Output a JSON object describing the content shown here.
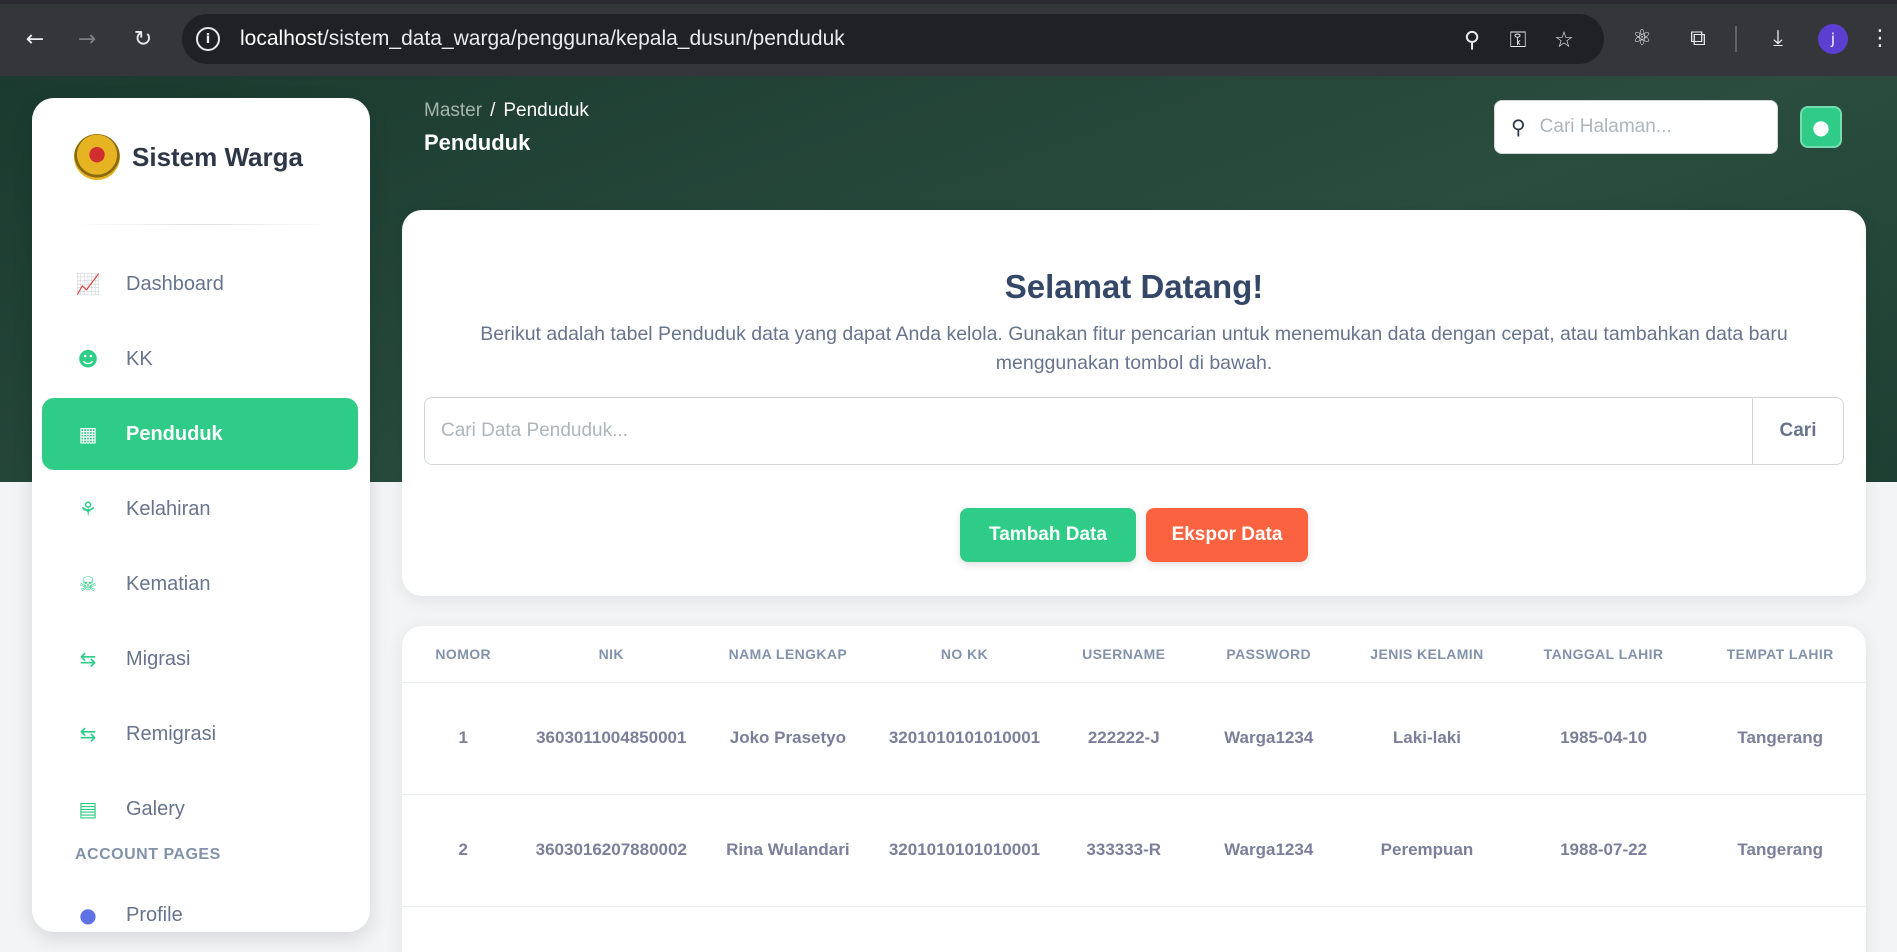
{
  "browser": {
    "url_host": "localhost",
    "url_path": "/sistem_data_warga/pengguna/kepala_dusun/penduduk",
    "profile_initial": "j"
  },
  "sidebar": {
    "brand": "Sistem Warga",
    "items": [
      {
        "label": "Dashboard",
        "icon": "chart-icon"
      },
      {
        "label": "KK",
        "icon": "users-icon"
      },
      {
        "label": "Penduduk",
        "icon": "id-card-icon",
        "active": true
      },
      {
        "label": "Kelahiran",
        "icon": "baby-icon"
      },
      {
        "label": "Kematian",
        "icon": "skull-icon"
      },
      {
        "label": "Migrasi",
        "icon": "exchange-icon"
      },
      {
        "label": "Remigrasi",
        "icon": "exchange-icon"
      },
      {
        "label": "Galery",
        "icon": "images-icon"
      }
    ],
    "section_label": "ACCOUNT PAGES",
    "account_items": [
      {
        "label": "Profile",
        "icon": "user-icon"
      }
    ]
  },
  "header": {
    "breadcrumb_root": "Master",
    "breadcrumb_sep": "/",
    "breadcrumb_current": "Penduduk",
    "title": "Penduduk",
    "search_placeholder": "Cari Halaman..."
  },
  "welcome": {
    "title": "Selamat Datang!",
    "description": "Berikut adalah tabel Penduduk data yang dapat Anda kelola. Gunakan fitur pencarian untuk menemukan data dengan cepat, atau tambahkan data baru menggunakan tombol di bawah.",
    "search_placeholder": "Cari Data Penduduk...",
    "search_button": "Cari",
    "add_button": "Tambah Data",
    "export_button": "Ekspor Data"
  },
  "table": {
    "columns": [
      "NOMOR",
      "NIK",
      "NAMA LENGKAP",
      "NO KK",
      "USERNAME",
      "PASSWORD",
      "JENIS KELAMIN",
      "TANGGAL LAHIR",
      "TEMPAT LAHIR"
    ],
    "rows": [
      [
        "1",
        "3603011004850001",
        "Joko Prasetyo",
        "3201010101010001",
        "222222-J",
        "Warga1234",
        "Laki-laki",
        "1985-04-10",
        "Tangerang"
      ],
      [
        "2",
        "3603016207880002",
        "Rina Wulandari",
        "3201010101010001",
        "333333-R",
        "Warga1234",
        "Perempuan",
        "1988-07-22",
        "Tangerang"
      ]
    ]
  },
  "colors": {
    "accent": "#2ecc87",
    "export": "#fb6340",
    "hero": "#1b3a2f"
  }
}
